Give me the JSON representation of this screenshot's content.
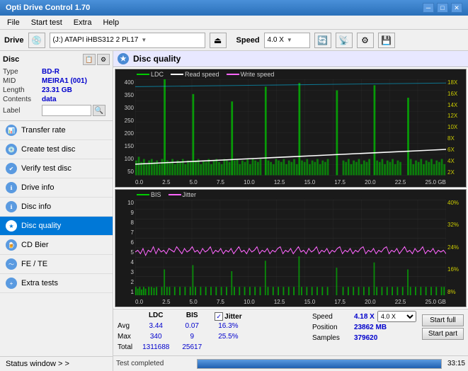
{
  "titleBar": {
    "title": "Opti Drive Control 1.70",
    "minimizeBtn": "─",
    "maximizeBtn": "□",
    "closeBtn": "✕"
  },
  "menuBar": {
    "items": [
      "File",
      "Start test",
      "Extra",
      "Help"
    ]
  },
  "toolbar": {
    "driveLabel": "Drive",
    "driveValue": "(J:) ATAPI iHBS312  2 PL17",
    "speedLabel": "Speed",
    "speedValue": "4.0 X"
  },
  "disc": {
    "title": "Disc",
    "typeLabel": "Type",
    "typeValue": "BD-R",
    "midLabel": "MID",
    "midValue": "MEIRA1 (001)",
    "lengthLabel": "Length",
    "lengthValue": "23.31 GB",
    "contentsLabel": "Contents",
    "contentsValue": "data",
    "labelLabel": "Label",
    "labelPlaceholder": ""
  },
  "navItems": [
    {
      "id": "transfer-rate",
      "label": "Transfer rate",
      "active": false
    },
    {
      "id": "create-test-disc",
      "label": "Create test disc",
      "active": false
    },
    {
      "id": "verify-test-disc",
      "label": "Verify test disc",
      "active": false
    },
    {
      "id": "drive-info",
      "label": "Drive info",
      "active": false
    },
    {
      "id": "disc-info",
      "label": "Disc info",
      "active": false
    },
    {
      "id": "disc-quality",
      "label": "Disc quality",
      "active": true
    },
    {
      "id": "cd-bier",
      "label": "CD Bier",
      "active": false
    },
    {
      "id": "fe-te",
      "label": "FE / TE",
      "active": false
    },
    {
      "id": "extra-tests",
      "label": "Extra tests",
      "active": false
    }
  ],
  "statusWindow": {
    "label": "Status window > >"
  },
  "discQuality": {
    "title": "Disc quality",
    "legend": {
      "ldc": "LDC",
      "readSpeed": "Read speed",
      "writeSpeed": "Write speed",
      "bis": "BIS",
      "jitter": "Jitter"
    }
  },
  "stats": {
    "headers": [
      "LDC",
      "BIS"
    ],
    "avg": {
      "label": "Avg",
      "ldc": "3.44",
      "bis": "0.07",
      "jitter": "16.3%"
    },
    "max": {
      "label": "Max",
      "ldc": "340",
      "bis": "9",
      "jitter": "25.5%"
    },
    "total": {
      "label": "Total",
      "ldc": "1311688",
      "bis": "25617"
    },
    "jitterLabel": "Jitter",
    "speedLabel": "Speed",
    "speedValue": "4.18 X",
    "speedSelect": "4.0 X",
    "positionLabel": "Position",
    "positionValue": "23862 MB",
    "samplesLabel": "Samples",
    "samplesValue": "379620",
    "startFull": "Start full",
    "startPart": "Start part"
  },
  "statusBar": {
    "text": "Test completed",
    "progress": 100,
    "time": "33:15"
  },
  "chart1": {
    "yLabels": [
      "400",
      "350",
      "300",
      "250",
      "200",
      "150",
      "100",
      "50"
    ],
    "yLabelsRight": [
      "18X",
      "16X",
      "14X",
      "12X",
      "10X",
      "8X",
      "6X",
      "4X",
      "2X"
    ],
    "xLabels": [
      "0.0",
      "2.5",
      "5.0",
      "7.5",
      "10.0",
      "12.5",
      "15.0",
      "17.5",
      "20.0",
      "22.5",
      "25.0 GB"
    ]
  },
  "chart2": {
    "yLabels": [
      "10",
      "9",
      "8",
      "7",
      "6",
      "5",
      "4",
      "3",
      "2",
      "1"
    ],
    "yLabelsRight": [
      "40%",
      "32%",
      "24%",
      "16%",
      "8%"
    ],
    "xLabels": [
      "0.0",
      "2.5",
      "5.0",
      "7.5",
      "10.0",
      "12.5",
      "15.0",
      "17.5",
      "20.0",
      "22.5",
      "25.0 GB"
    ]
  }
}
